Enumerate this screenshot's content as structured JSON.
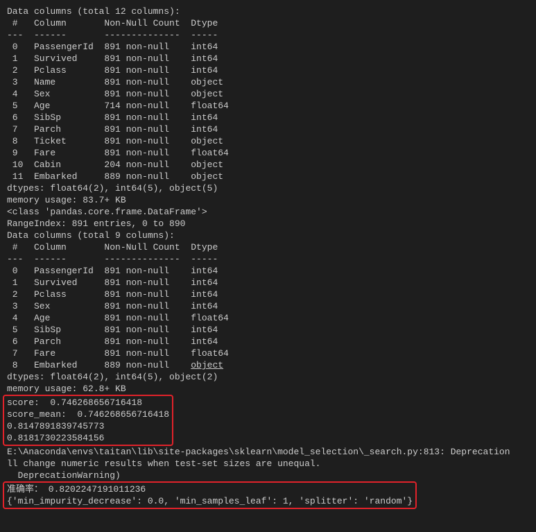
{
  "section1": {
    "header": "Data columns (total 12 columns):",
    "col_header_line": " #   Column       Non-Null Count  Dtype  ",
    "divider_line": "---  ------       --------------  -----  ",
    "rows": [
      " 0   PassengerId  891 non-null    int64  ",
      " 1   Survived     891 non-null    int64  ",
      " 2   Pclass       891 non-null    int64  ",
      " 3   Name         891 non-null    object ",
      " 4   Sex          891 non-null    object ",
      " 5   Age          714 non-null    float64",
      " 6   SibSp        891 non-null    int64  ",
      " 7   Parch        891 non-null    int64  ",
      " 8   Ticket       891 non-null    object ",
      " 9   Fare         891 non-null    float64",
      " 10  Cabin        204 non-null    object ",
      " 11  Embarked     889 non-null    object "
    ],
    "dtypes_line": "dtypes: float64(2), int64(5), object(5)",
    "memory_line": "memory usage: 83.7+ KB"
  },
  "class_line": "<class 'pandas.core.frame.DataFrame'>",
  "range_index_line": "RangeIndex: 891 entries, 0 to 890",
  "section2": {
    "header": "Data columns (total 9 columns):",
    "col_header_line": " #   Column       Non-Null Count  Dtype  ",
    "divider_line": "---  ------       --------------  -----  ",
    "rows_prefix": [
      " 0   PassengerId  891 non-null    int64  ",
      " 1   Survived     891 non-null    int64  ",
      " 2   Pclass       891 non-null    int64  ",
      " 3   Sex          891 non-null    int64  ",
      " 4   Age          891 non-null    float64",
      " 5   SibSp        891 non-null    int64  ",
      " 6   Parch        891 non-null    int64  ",
      " 7   Fare         891 non-null    float64"
    ],
    "row8_prefix": " 8   Embarked     889 non-null    ",
    "row8_dtype": "object",
    "dtypes_line": "dtypes: float64(2), int64(5), object(2)",
    "memory_line": "memory usage: 62.8+ KB"
  },
  "box1": {
    "line1": "score:  0.746268656716418",
    "line2": "score_mean:  0.746268656716418",
    "line3": "0.8147891839745773",
    "line4": "0.8181730223584156"
  },
  "warning": {
    "line1": "E:\\Anaconda\\envs\\taitan\\lib\\site-packages\\sklearn\\model_selection\\_search.py:813: Deprecation",
    "line2": "ll change numeric results when test-set sizes are unequal.",
    "line3": "  DeprecationWarning)"
  },
  "box2": {
    "line1": "准确率： 0.8202247191011236",
    "line2": "{'min_impurity_decrease': 0.0, 'min_samples_leaf': 1, 'splitter': 'random'}"
  }
}
